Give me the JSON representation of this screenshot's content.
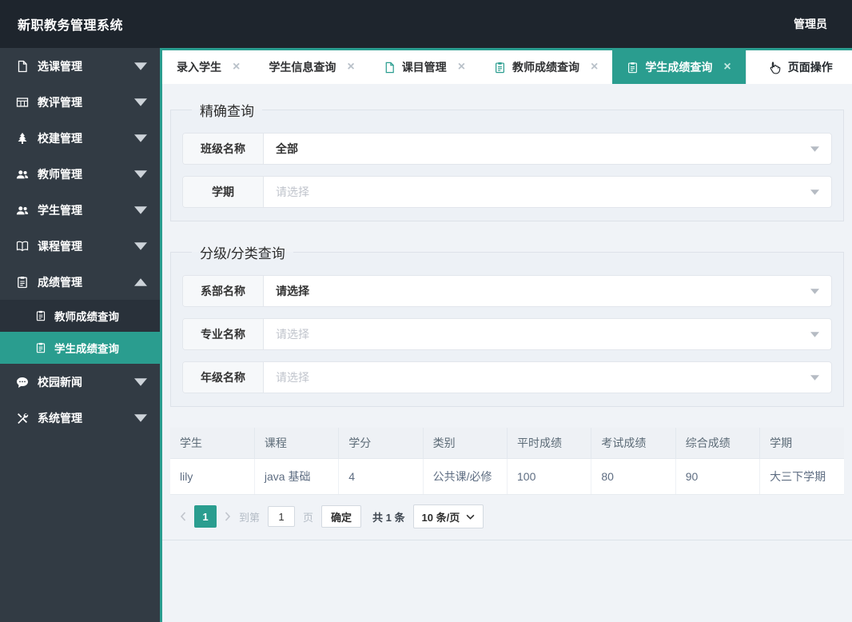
{
  "header": {
    "title": "新职教务管理系统",
    "user": "管理员"
  },
  "colors": {
    "accent": "#2a9d8f",
    "header_bg": "#1e252d",
    "sidebar_bg": "#323b44",
    "submenu_bg": "#29313a",
    "content_bg": "#f0f3f7"
  },
  "sidebar": {
    "items": [
      {
        "label": "选课管理",
        "icon": "file-icon",
        "state": "collapsed"
      },
      {
        "label": "教评管理",
        "icon": "table-icon",
        "state": "collapsed"
      },
      {
        "label": "校建管理",
        "icon": "tree-icon",
        "state": "collapsed"
      },
      {
        "label": "教师管理",
        "icon": "users-icon",
        "state": "collapsed"
      },
      {
        "label": "学生管理",
        "icon": "users-icon",
        "state": "collapsed"
      },
      {
        "label": "课程管理",
        "icon": "book-icon",
        "state": "collapsed"
      },
      {
        "label": "成绩管理",
        "icon": "clipboard-icon",
        "state": "expanded",
        "children": [
          {
            "label": "教师成绩查询",
            "icon": "clipboard-icon",
            "active": false
          },
          {
            "label": "学生成绩查询",
            "icon": "clipboard-icon",
            "active": true
          }
        ]
      },
      {
        "label": "校园新闻",
        "icon": "comment-icon",
        "state": "collapsed"
      },
      {
        "label": "系统管理",
        "icon": "tools-icon",
        "state": "collapsed"
      }
    ]
  },
  "tabs": [
    {
      "label": "录入学生",
      "icon": null,
      "closable": true,
      "active": false
    },
    {
      "label": "学生信息查询",
      "icon": null,
      "closable": true,
      "active": false
    },
    {
      "label": "课目管理",
      "icon": "file-icon",
      "closable": true,
      "active": false
    },
    {
      "label": "教师成绩查询",
      "icon": "clipboard-icon",
      "closable": true,
      "active": false
    },
    {
      "label": "学生成绩查询",
      "icon": "clipboard-icon",
      "closable": true,
      "active": true
    }
  ],
  "page_actions": {
    "label": "页面操作",
    "icon": "hand-pointer-icon"
  },
  "precise_query": {
    "legend": "精确查询",
    "fields": [
      {
        "label": "班级名称",
        "value": "全部",
        "placeholder": false
      },
      {
        "label": "学期",
        "value": "请选择",
        "placeholder": true
      }
    ]
  },
  "category_query": {
    "legend": "分级/分类查询",
    "fields": [
      {
        "label": "系部名称",
        "value": "请选择",
        "placeholder": false
      },
      {
        "label": "专业名称",
        "value": "请选择",
        "placeholder": true
      },
      {
        "label": "年级名称",
        "value": "请选择",
        "placeholder": true
      }
    ]
  },
  "table": {
    "headers": [
      "学生",
      "课程",
      "学分",
      "类别",
      "平时成绩",
      "考试成绩",
      "综合成绩",
      "学期"
    ],
    "rows": [
      [
        "lily",
        "java 基础",
        "4",
        "公共课/必修",
        "100",
        "80",
        "90",
        "大三下学期"
      ]
    ]
  },
  "pagination": {
    "current_page": "1",
    "goto_label": "到第",
    "goto_value": "1",
    "page_label": "页",
    "confirm_label": "确定",
    "total_label": "共 1 条",
    "page_size": "10 条/页"
  }
}
